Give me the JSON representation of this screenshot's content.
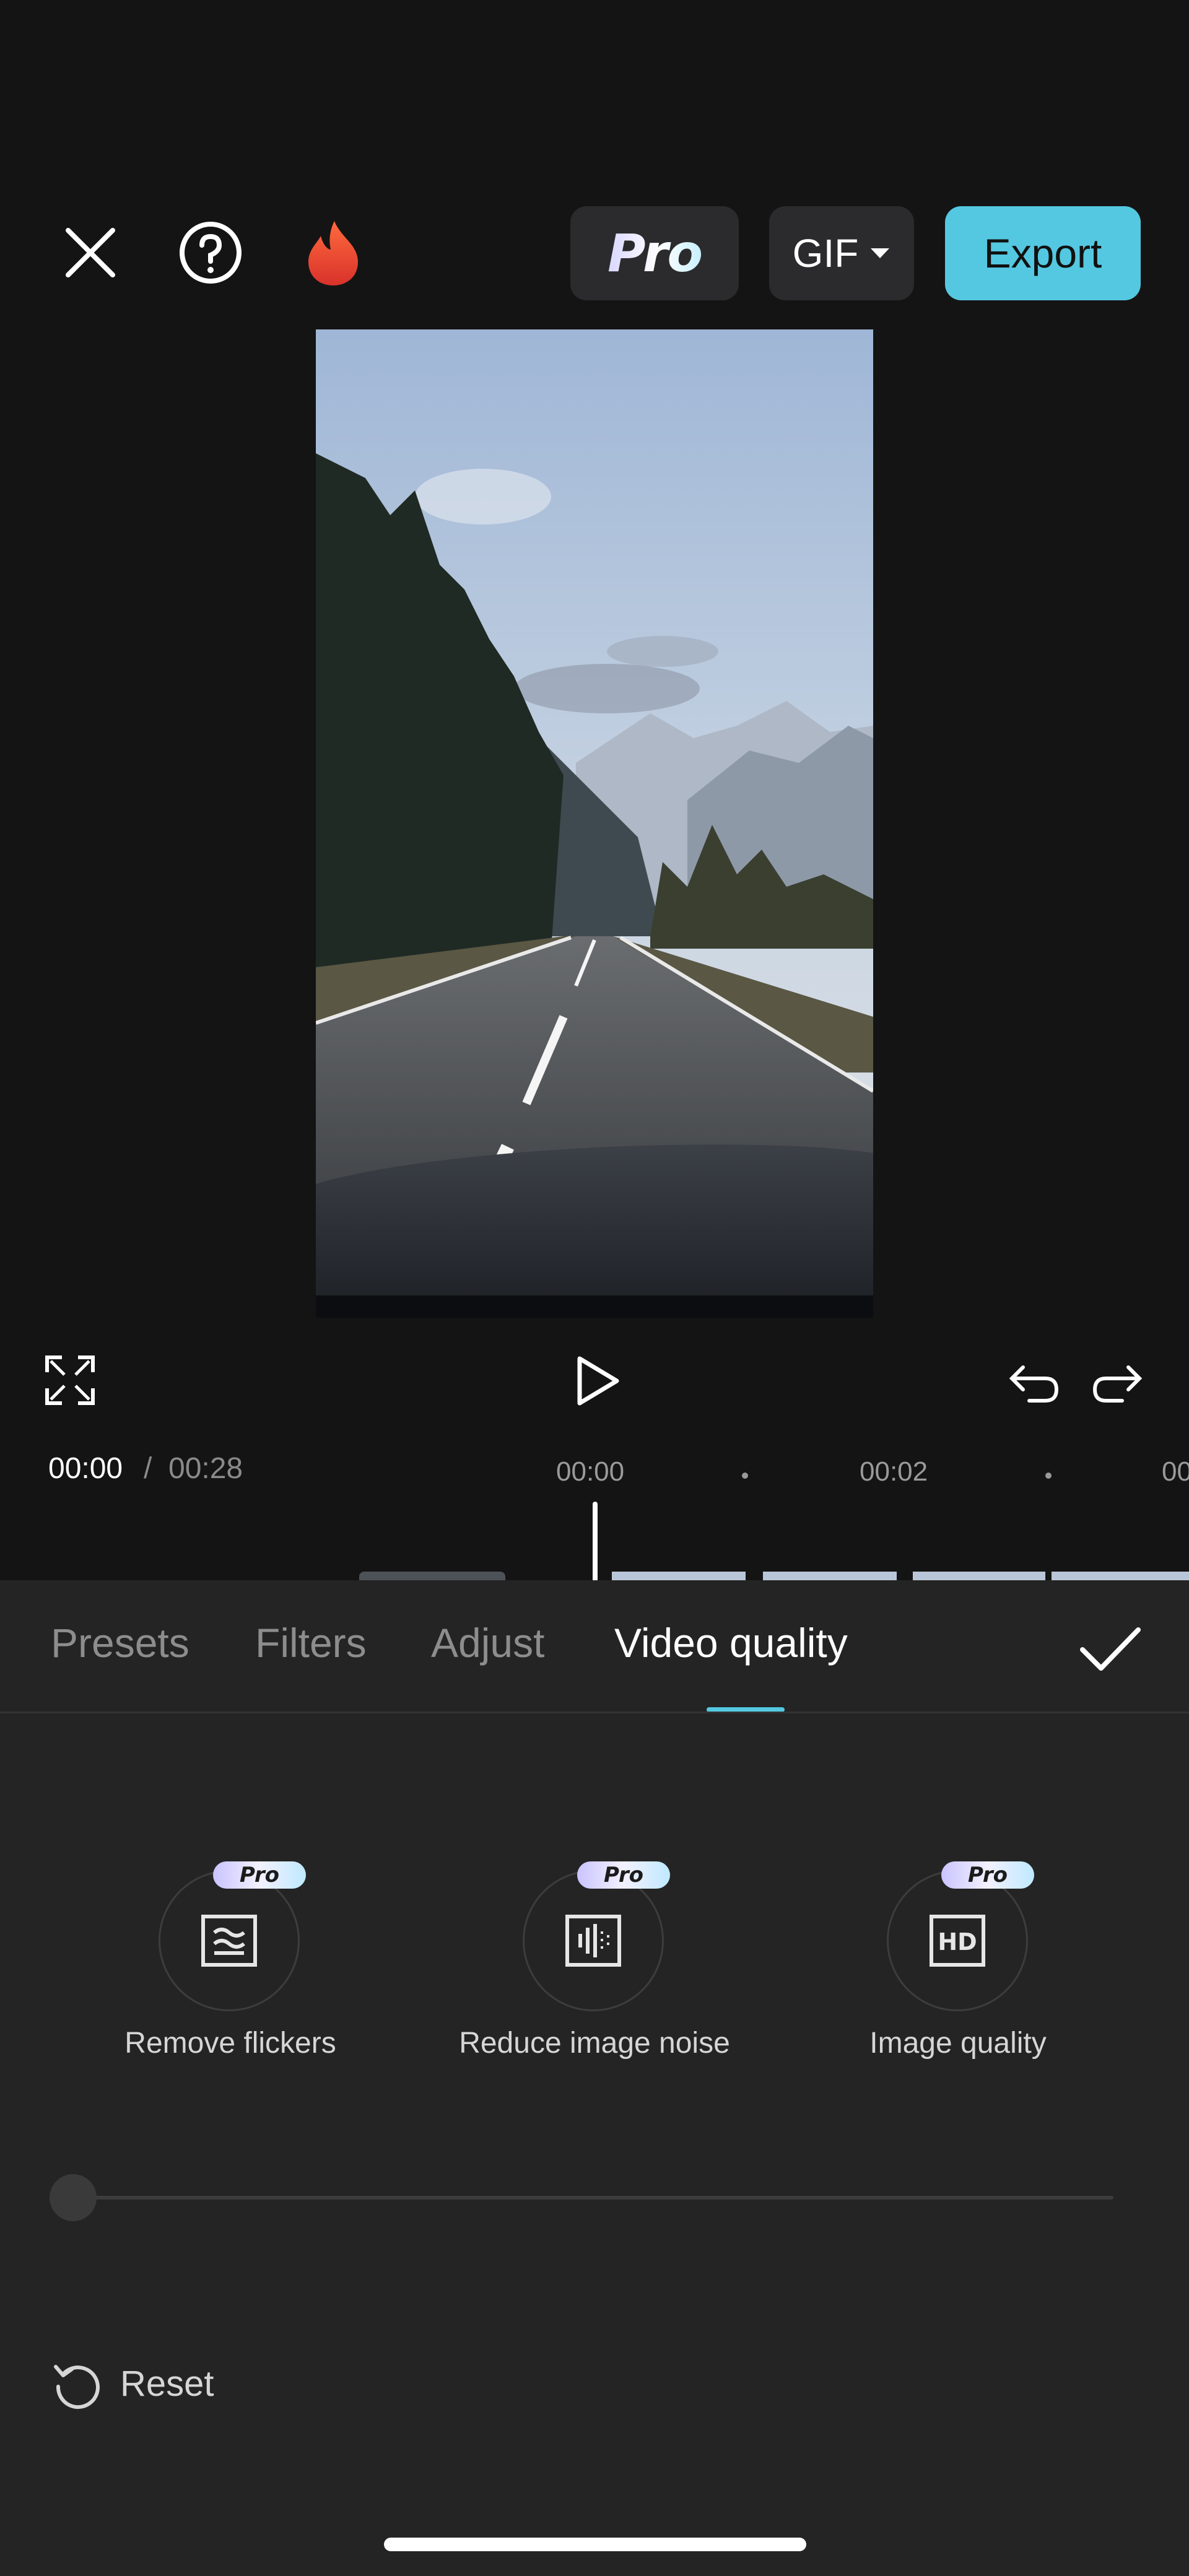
{
  "top_bar": {
    "close_icon": "close-icon",
    "help_icon": "help-icon",
    "trending_icon": "fire-icon",
    "pro_label": "Pro",
    "format_label": "GIF",
    "export_label": "Export"
  },
  "preview": {
    "content": "road-through-mountain-valley"
  },
  "controls": {
    "fullscreen_icon": "fullscreen-icon",
    "play_icon": "play-icon",
    "undo_icon": "undo-icon",
    "redo_icon": "redo-icon"
  },
  "timeline": {
    "current_time": "00:00",
    "separator": "/",
    "total_time": "00:28",
    "ticks": [
      "00:00",
      "00:02",
      "00"
    ]
  },
  "panel": {
    "tabs": [
      {
        "label": "Presets",
        "active": false
      },
      {
        "label": "Filters",
        "active": false
      },
      {
        "label": "Adjust",
        "active": false
      },
      {
        "label": "Video quality",
        "active": true
      }
    ],
    "confirm_icon": "check-icon",
    "features": [
      {
        "label": "Remove flickers",
        "badge": "Pro",
        "icon": "flicker-icon"
      },
      {
        "label": "Reduce image noise",
        "badge": "Pro",
        "icon": "noise-icon"
      },
      {
        "label": "Image quality",
        "badge": "Pro",
        "icon": "hd-icon"
      }
    ],
    "slider_value": 0,
    "reset_label": "Reset"
  },
  "colors": {
    "accent": "#54c8e0",
    "background": "#141414",
    "panel": "#242424"
  }
}
